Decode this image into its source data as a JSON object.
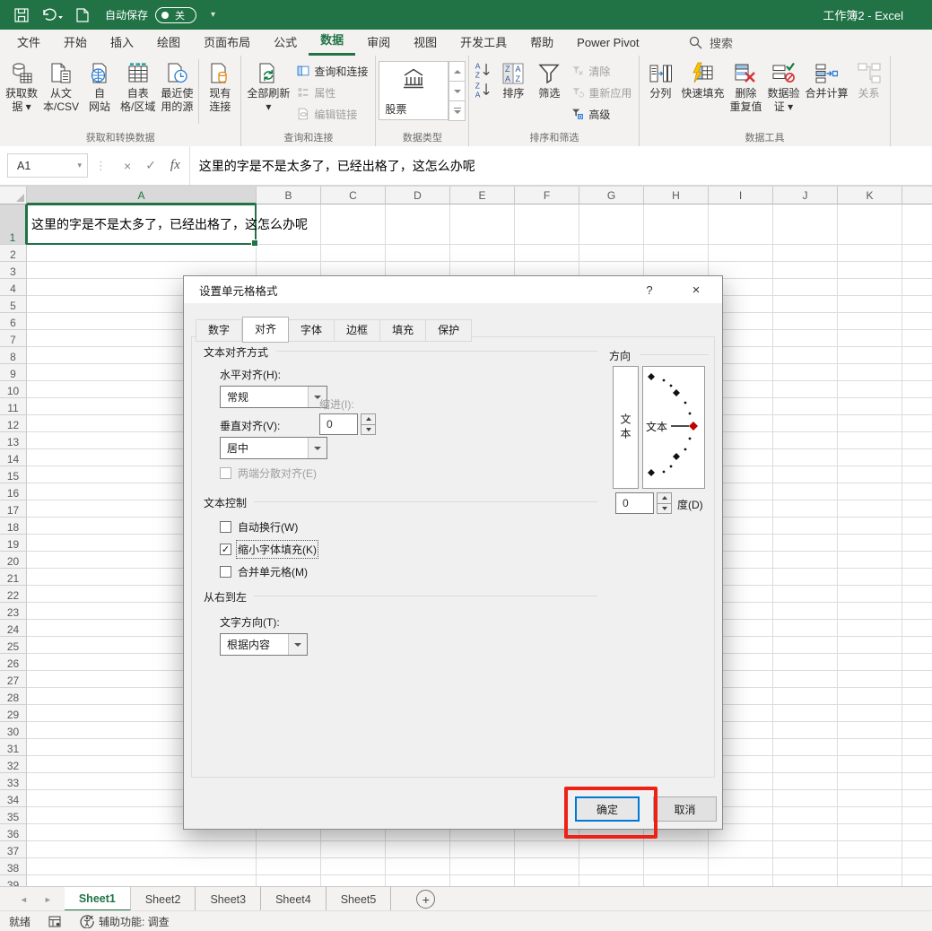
{
  "titlebar": {
    "autosave_label": "自动保存",
    "autosave_state": "关",
    "title": "工作簿2 - Excel"
  },
  "menu": {
    "tabs": [
      {
        "name": "tab-file",
        "label": "文件",
        "active": false
      },
      {
        "name": "tab-home",
        "label": "开始",
        "active": false
      },
      {
        "name": "tab-insert",
        "label": "插入",
        "active": false
      },
      {
        "name": "tab-draw",
        "label": "绘图",
        "active": false
      },
      {
        "name": "tab-page-layout",
        "label": "页面布局",
        "active": false
      },
      {
        "name": "tab-formulas",
        "label": "公式",
        "active": false
      },
      {
        "name": "tab-data",
        "label": "数据",
        "active": true
      },
      {
        "name": "tab-review",
        "label": "审阅",
        "active": false
      },
      {
        "name": "tab-view",
        "label": "视图",
        "active": false
      },
      {
        "name": "tab-developer",
        "label": "开发工具",
        "active": false
      },
      {
        "name": "tab-help",
        "label": "帮助",
        "active": false
      },
      {
        "name": "tab-power-pivot",
        "label": "Power Pivot",
        "active": false
      }
    ],
    "search_label": "搜索"
  },
  "ribbon": {
    "groups": [
      {
        "label": "获取和转换数据",
        "items": [
          {
            "type": "large",
            "name": "get-data-button",
            "icon": "get-data",
            "lines": [
              "获取数",
              "据 ▾"
            ]
          },
          {
            "type": "large",
            "name": "from-text-csv-button",
            "icon": "from-text",
            "lines": [
              "从文",
              "本/CSV"
            ]
          },
          {
            "type": "large",
            "name": "from-web-button",
            "icon": "from-web",
            "lines": [
              "自",
              "网站"
            ]
          },
          {
            "type": "large",
            "name": "from-table-range-button",
            "icon": "from-table",
            "lines": [
              "自表",
              "格/区域"
            ]
          },
          {
            "type": "large",
            "name": "recent-sources-button",
            "icon": "recent-sources",
            "lines": [
              "最近使",
              "用的源"
            ]
          },
          {
            "type": "divider"
          },
          {
            "type": "large",
            "name": "existing-connections-button",
            "icon": "existing-connections",
            "lines": [
              "现有",
              "连接"
            ]
          }
        ]
      },
      {
        "label": "查询和连接",
        "items": [
          {
            "type": "large",
            "name": "refresh-all-button",
            "icon": "refresh-all",
            "lines": [
              "全部刷新",
              "▾"
            ]
          },
          {
            "type": "stack",
            "buttons": [
              {
                "name": "queries-connections-button",
                "icon": "queries",
                "label": "查询和连接",
                "disabled": false
              },
              {
                "name": "properties-button",
                "icon": "properties",
                "label": "属性",
                "disabled": true
              },
              {
                "name": "edit-links-button",
                "icon": "edit-links",
                "label": "编辑链接",
                "disabled": true
              }
            ]
          }
        ]
      },
      {
        "label": "数据类型",
        "items": [
          {
            "type": "gallery",
            "name": "stock-data-type",
            "icon": "stock",
            "label": "股票"
          }
        ]
      },
      {
        "label": "排序和筛选",
        "items": [
          {
            "type": "sortpair"
          },
          {
            "type": "large",
            "name": "sort-button",
            "icon": "sort",
            "lines": [
              "排序"
            ]
          },
          {
            "type": "large",
            "name": "filter-button",
            "icon": "filter",
            "lines": [
              "筛选"
            ]
          },
          {
            "type": "stack",
            "buttons": [
              {
                "name": "clear-button",
                "icon": "clear-filter",
                "label": "清除",
                "disabled": true
              },
              {
                "name": "reapply-button",
                "icon": "reapply",
                "label": "重新应用",
                "disabled": true
              },
              {
                "name": "advanced-button",
                "icon": "advanced",
                "label": "高级",
                "disabled": false
              }
            ]
          }
        ]
      },
      {
        "label": "数据工具",
        "items": [
          {
            "type": "large",
            "name": "text-to-columns-button",
            "icon": "text-to-columns",
            "lines": [
              "分列"
            ]
          },
          {
            "type": "large",
            "name": "flash-fill-button",
            "icon": "flash-fill",
            "lines": [
              "快速填充"
            ]
          },
          {
            "type": "large",
            "name": "remove-duplicates-button",
            "icon": "remove-duplicates",
            "lines": [
              "删除",
              "重复值"
            ]
          },
          {
            "type": "large",
            "name": "data-validation-button",
            "icon": "data-validation",
            "lines": [
              "数据验",
              "证 ▾"
            ]
          },
          {
            "type": "large",
            "name": "consolidate-button",
            "icon": "consolidate",
            "lines": [
              "合并计算"
            ]
          },
          {
            "type": "large",
            "name": "relationships-button",
            "icon": "relationships",
            "lines": [
              "关系"
            ],
            "disabled": true
          }
        ]
      }
    ]
  },
  "formula_bar": {
    "cell_ref": "A1",
    "cancel_icon": "×",
    "enter_icon": "✓",
    "fx_icon": "fx",
    "formula": "这里的字是不是太多了，已经出格了，这怎么办呢"
  },
  "grid": {
    "columns": [
      "A",
      "B",
      "C",
      "D",
      "E",
      "F",
      "G",
      "H",
      "I",
      "J",
      "K",
      ""
    ],
    "row_count": 39,
    "selected_cell": "A1",
    "a1_text": "这里的字是不是太多了，已经出格了，这怎么办呢"
  },
  "dialog": {
    "title": "设置单元格格式",
    "help_icon": "?",
    "close_icon": "×",
    "tabs": [
      {
        "name": "dialog-tab-number",
        "label": "数字",
        "active": false
      },
      {
        "name": "dialog-tab-alignment",
        "label": "对齐",
        "active": true
      },
      {
        "name": "dialog-tab-font",
        "label": "字体",
        "active": false
      },
      {
        "name": "dialog-tab-border",
        "label": "边框",
        "active": false
      },
      {
        "name": "dialog-tab-fill",
        "label": "填充",
        "active": false
      },
      {
        "name": "dialog-tab-protection",
        "label": "保护",
        "active": false
      }
    ],
    "text_alignment": {
      "section_label": "文本对齐方式",
      "horizontal_label": "水平对齐(H):",
      "horizontal_value": "常规",
      "indent_label": "缩进(I):",
      "indent_value": "0",
      "vertical_label": "垂直对齐(V):",
      "vertical_value": "居中",
      "justify_checkbox": "两端分散对齐(E)"
    },
    "text_control": {
      "section_label": "文本控制",
      "wrap": "自动换行(W)",
      "shrink": "缩小字体填充(K)",
      "shrink_checked": true,
      "check_glyph": "✓",
      "merge": "合并单元格(M)"
    },
    "rtl": {
      "section_label": "从右到左",
      "direction_label": "文字方向(T):",
      "direction_value": "根据内容"
    },
    "orientation": {
      "section_label": "方向",
      "side_text": "文本",
      "dial_text": "文本",
      "degrees_value": "0",
      "degrees_label": "度(D)"
    },
    "ok_label": "确定",
    "cancel_label": "取消"
  },
  "sheet_bar": {
    "tabs": [
      {
        "name": "sheet-tab-1",
        "label": "Sheet1",
        "active": true
      },
      {
        "name": "sheet-tab-2",
        "label": "Sheet2",
        "active": false
      },
      {
        "name": "sheet-tab-3",
        "label": "Sheet3",
        "active": false
      },
      {
        "name": "sheet-tab-4",
        "label": "Sheet4",
        "active": false
      },
      {
        "name": "sheet-tab-5",
        "label": "Sheet5",
        "active": false
      }
    ],
    "nav_left_icon": "◄",
    "nav_right_icon": "►",
    "add_label": "+"
  },
  "status_bar": {
    "ready": "就绪",
    "accessibility": "辅助功能: 调查"
  }
}
